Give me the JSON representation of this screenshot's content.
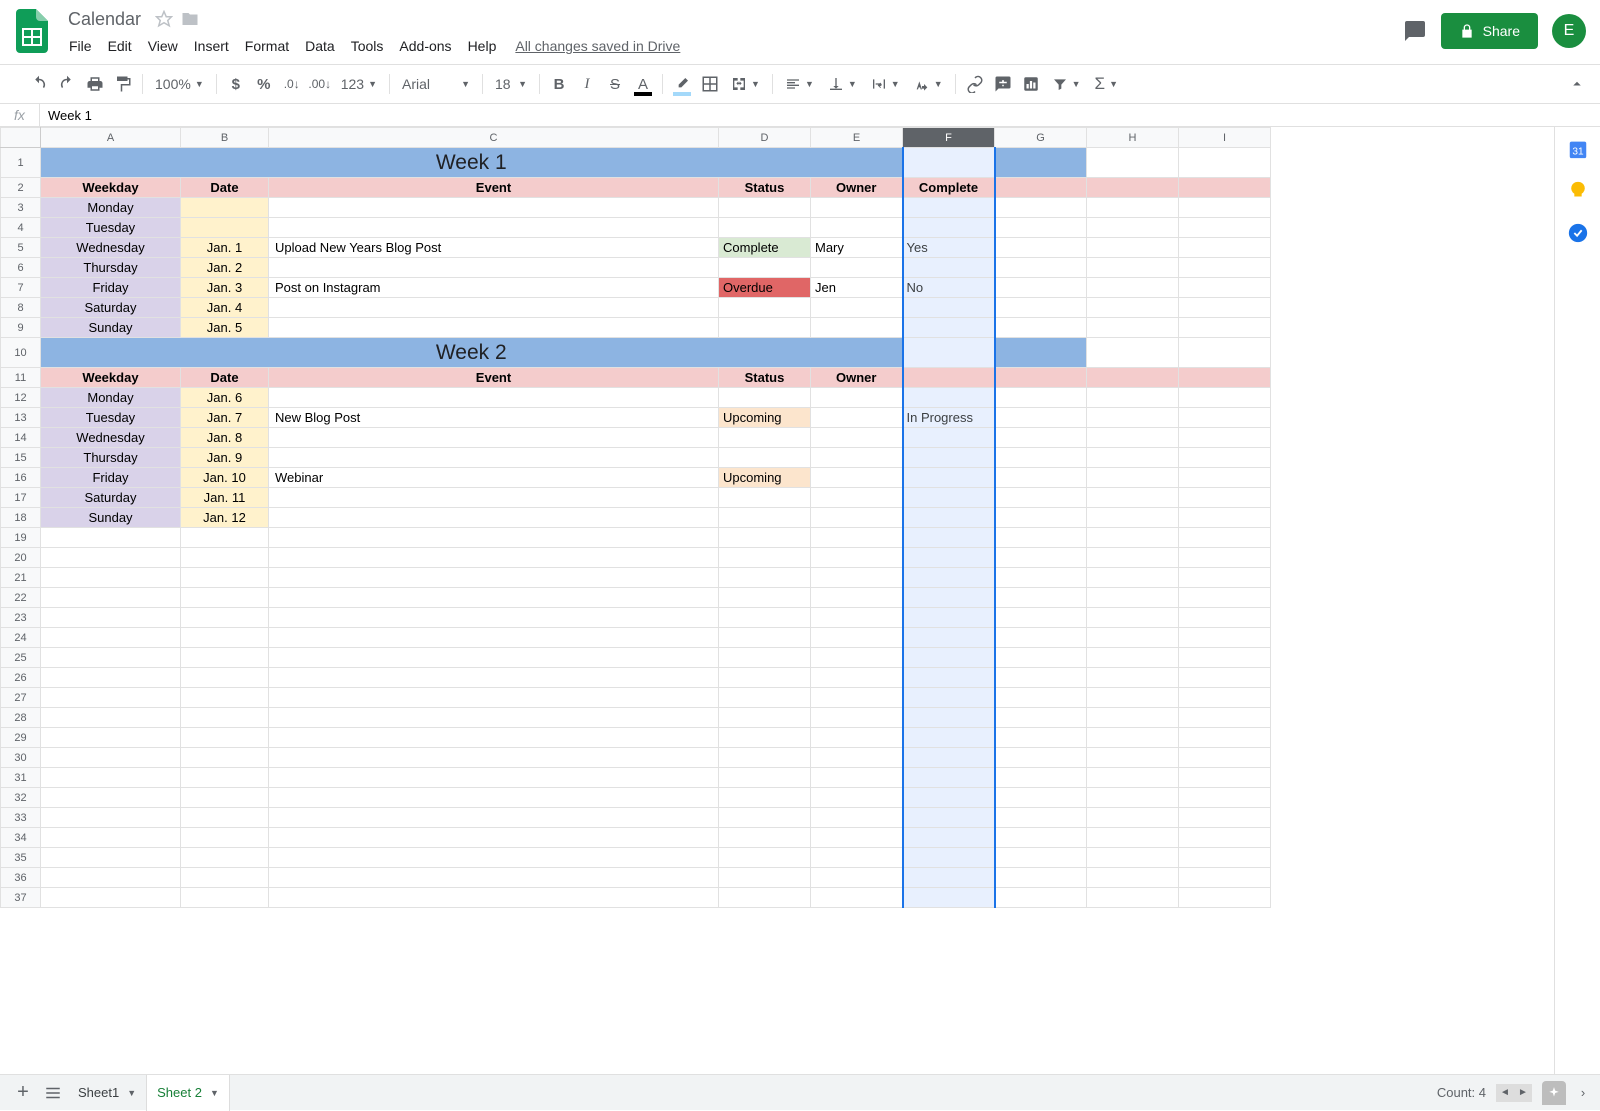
{
  "doc": {
    "title": "Calendar",
    "save_status": "All changes saved in Drive"
  },
  "menu": [
    "File",
    "Edit",
    "View",
    "Insert",
    "Format",
    "Data",
    "Tools",
    "Add-ons",
    "Help"
  ],
  "share": {
    "label": "Share"
  },
  "avatar": {
    "letter": "E"
  },
  "toolbar": {
    "zoom": "100%",
    "fmt123": "123",
    "font": "Arial",
    "font_size": "18"
  },
  "formula": {
    "fx": "fx",
    "value": "Week 1"
  },
  "columns": [
    "A",
    "B",
    "C",
    "D",
    "E",
    "F",
    "G",
    "H",
    "I"
  ],
  "selected_col_index": 5,
  "row_count": 37,
  "week1": {
    "title": "Week 1",
    "headers": [
      "Weekday",
      "Date",
      "Event",
      "Status",
      "Owner",
      "Complete"
    ],
    "rows": [
      {
        "weekday": "Monday",
        "date": "",
        "event": "",
        "status": {
          "text": "",
          "type": ""
        },
        "owner": "",
        "complete": ""
      },
      {
        "weekday": "Tuesday",
        "date": "",
        "event": "",
        "status": {
          "text": "",
          "type": ""
        },
        "owner": "",
        "complete": ""
      },
      {
        "weekday": "Wednesday",
        "date": "Jan. 1",
        "event": "Upload New Years Blog Post",
        "status": {
          "text": "Complete",
          "type": "complete"
        },
        "owner": "Mary",
        "complete": "Yes"
      },
      {
        "weekday": "Thursday",
        "date": "Jan. 2",
        "event": "",
        "status": {
          "text": "",
          "type": ""
        },
        "owner": "",
        "complete": ""
      },
      {
        "weekday": "Friday",
        "date": "Jan. 3",
        "event": "Post on Instagram",
        "status": {
          "text": "Overdue",
          "type": "overdue"
        },
        "owner": "Jen",
        "complete": "No"
      },
      {
        "weekday": "Saturday",
        "date": "Jan. 4",
        "event": "",
        "status": {
          "text": "",
          "type": ""
        },
        "owner": "",
        "complete": ""
      },
      {
        "weekday": "Sunday",
        "date": "Jan. 5",
        "event": "",
        "status": {
          "text": "",
          "type": ""
        },
        "owner": "",
        "complete": ""
      }
    ]
  },
  "week2": {
    "title": "Week 2",
    "headers": [
      "Weekday",
      "Date",
      "Event",
      "Status",
      "Owner",
      ""
    ],
    "rows": [
      {
        "weekday": "Monday",
        "date": "Jan. 6",
        "event": "",
        "status": {
          "text": "",
          "type": ""
        },
        "owner": "",
        "complete": ""
      },
      {
        "weekday": "Tuesday",
        "date": "Jan. 7",
        "event": "New Blog Post",
        "status": {
          "text": "Upcoming",
          "type": "upcoming"
        },
        "owner": "",
        "complete": "In Progress"
      },
      {
        "weekday": "Wednesday",
        "date": "Jan. 8",
        "event": "",
        "status": {
          "text": "",
          "type": ""
        },
        "owner": "",
        "complete": ""
      },
      {
        "weekday": "Thursday",
        "date": "Jan. 9",
        "event": "",
        "status": {
          "text": "",
          "type": ""
        },
        "owner": "",
        "complete": ""
      },
      {
        "weekday": "Friday",
        "date": "Jan. 10",
        "event": "Webinar",
        "status": {
          "text": "Upcoming",
          "type": "upcoming"
        },
        "owner": "",
        "complete": ""
      },
      {
        "weekday": "Saturday",
        "date": "Jan. 11",
        "event": "",
        "status": {
          "text": "",
          "type": ""
        },
        "owner": "",
        "complete": ""
      },
      {
        "weekday": "Sunday",
        "date": "Jan. 12",
        "event": "",
        "status": {
          "text": "",
          "type": ""
        },
        "owner": "",
        "complete": ""
      }
    ]
  },
  "sheet_bar": {
    "tabs": [
      {
        "name": "Sheet1",
        "active": false
      },
      {
        "name": "Sheet 2",
        "active": true
      }
    ],
    "count": "Count: 4"
  }
}
